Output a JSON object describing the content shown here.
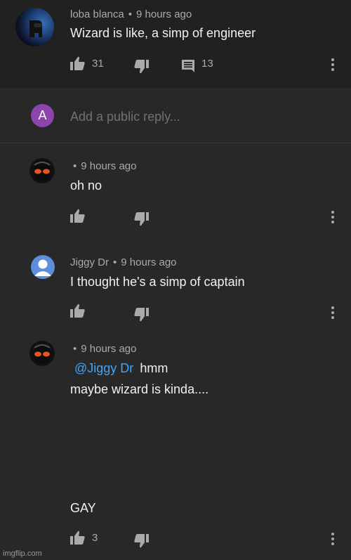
{
  "top_comment": {
    "author": "loba blanca",
    "time": "9 hours ago",
    "text": "Wizard is like, a simp of engineer",
    "likes": "31",
    "replies": "13"
  },
  "reply_box": {
    "avatar_letter": "A",
    "placeholder": "Add a public reply..."
  },
  "replies": [
    {
      "author": "",
      "time": "9 hours ago",
      "text": "oh no"
    },
    {
      "author": "Jiggy Dr",
      "time": "9 hours ago",
      "text": "I thought he's a simp of captain"
    },
    {
      "author": "",
      "time": "9 hours ago",
      "mention": "@Jiggy Dr",
      "text_after_mention": "hmm",
      "line2": "maybe wizard is kinda....",
      "line3": "GAY",
      "likes": "3"
    }
  ],
  "watermark": "imgflip.com",
  "colors": {
    "background": "#282828",
    "top_background": "#212121",
    "mention": "#3ea6ff",
    "reply_avatar": "#8e44ad",
    "default_avatar": "#5b8fd9"
  }
}
